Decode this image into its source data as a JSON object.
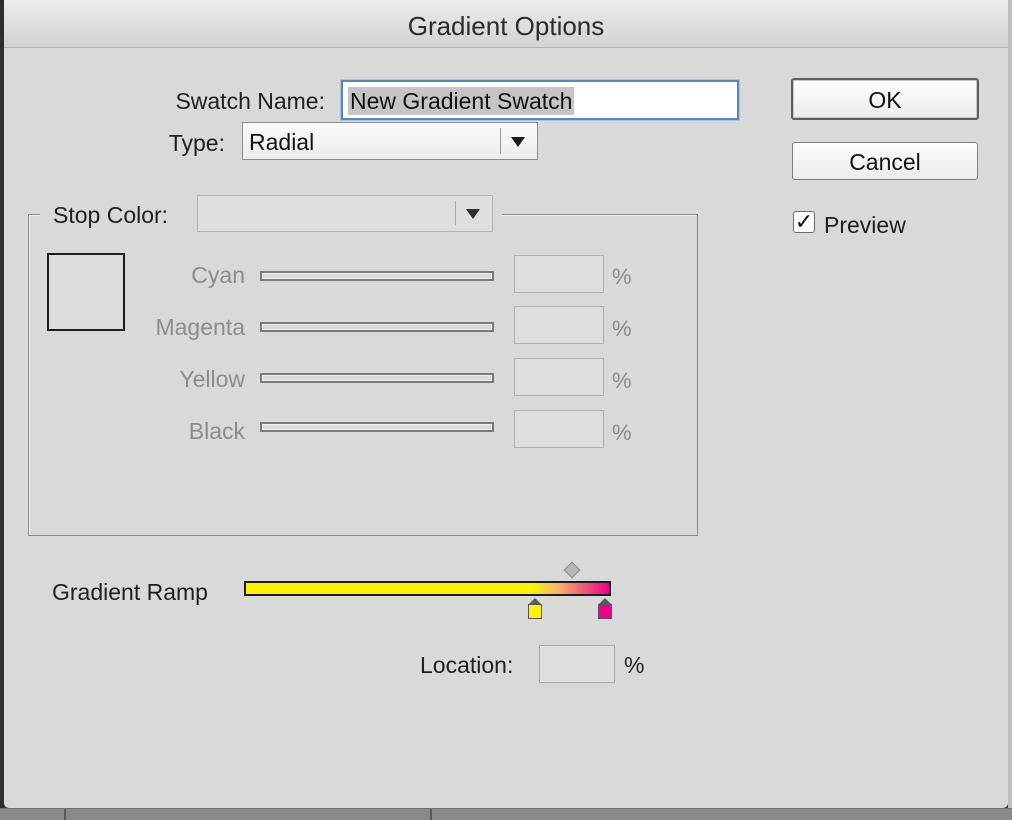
{
  "dialog": {
    "title": "Gradient Options"
  },
  "swatch_name": {
    "label": "Swatch Name:",
    "value": "New Gradient Swatch"
  },
  "type": {
    "label": "Type:",
    "value": "Radial"
  },
  "buttons": {
    "ok": "OK",
    "cancel": "Cancel"
  },
  "preview": {
    "label": "Preview",
    "checked": true,
    "check_glyph": "✓"
  },
  "stop_color": {
    "label": "Stop Color:",
    "value": "",
    "sliders": [
      {
        "label": "Cyan",
        "value": "",
        "unit": "%"
      },
      {
        "label": "Magenta",
        "value": "",
        "unit": "%"
      },
      {
        "label": "Yellow",
        "value": "",
        "unit": "%"
      },
      {
        "label": "Black",
        "value": "",
        "unit": "%"
      }
    ]
  },
  "gradient_ramp": {
    "label": "Gradient Ramp",
    "stops": [
      {
        "color": "#fff200",
        "location_fraction": 0.79
      },
      {
        "color": "#ec008c",
        "location_fraction": 1.0
      }
    ],
    "midpoint_fraction": 0.89
  },
  "location": {
    "label": "Location:",
    "value": "",
    "unit": "%"
  }
}
